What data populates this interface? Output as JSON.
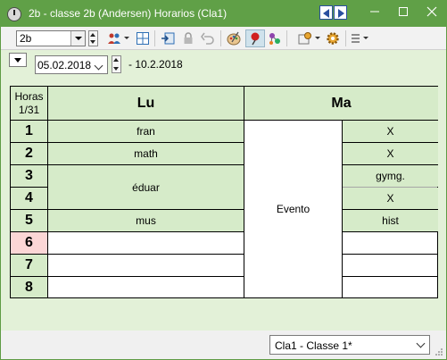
{
  "window": {
    "title": "2b - classe 2b (Andersen)  Horarios  (Cla1)",
    "app_icon": "clock-icon",
    "controls": [
      "minimize-icon",
      "maximize-icon",
      "close-icon"
    ],
    "accent_color": "#60a047"
  },
  "toolbar": {
    "class_value": "2b",
    "icons": [
      "people-icon",
      "grid-icon",
      "export-icon",
      "lock-icon",
      "undo-icon",
      "palette-icon",
      "pushpin-icon",
      "molecule-icon",
      "settings-icon",
      "gear-icon",
      "list-icon"
    ]
  },
  "date_bar": {
    "start_date": "05.02.2018",
    "range_end": "- 10.2.2018"
  },
  "timetable": {
    "corner_line1": "Horas",
    "corner_line2": "1/31",
    "days": [
      "Lu",
      "Ma"
    ],
    "hours": [
      "1",
      "2",
      "3",
      "4",
      "5",
      "6",
      "7",
      "8"
    ],
    "highlight_hour": "6",
    "lu": {
      "h1": "fran",
      "h2": "math",
      "h3_4": "éduar",
      "h5": "mus"
    },
    "ma": {
      "event": "Evento",
      "h1": "X",
      "h2": "X",
      "h3": "gymg.",
      "h4": "X",
      "h5": "hist"
    },
    "colors": {
      "lesson_bg": "#d6ebc9",
      "highlight_bg": "#fcd6d6"
    }
  },
  "status_bar": {
    "combo_value": "Cla1 - Classe 1*"
  }
}
